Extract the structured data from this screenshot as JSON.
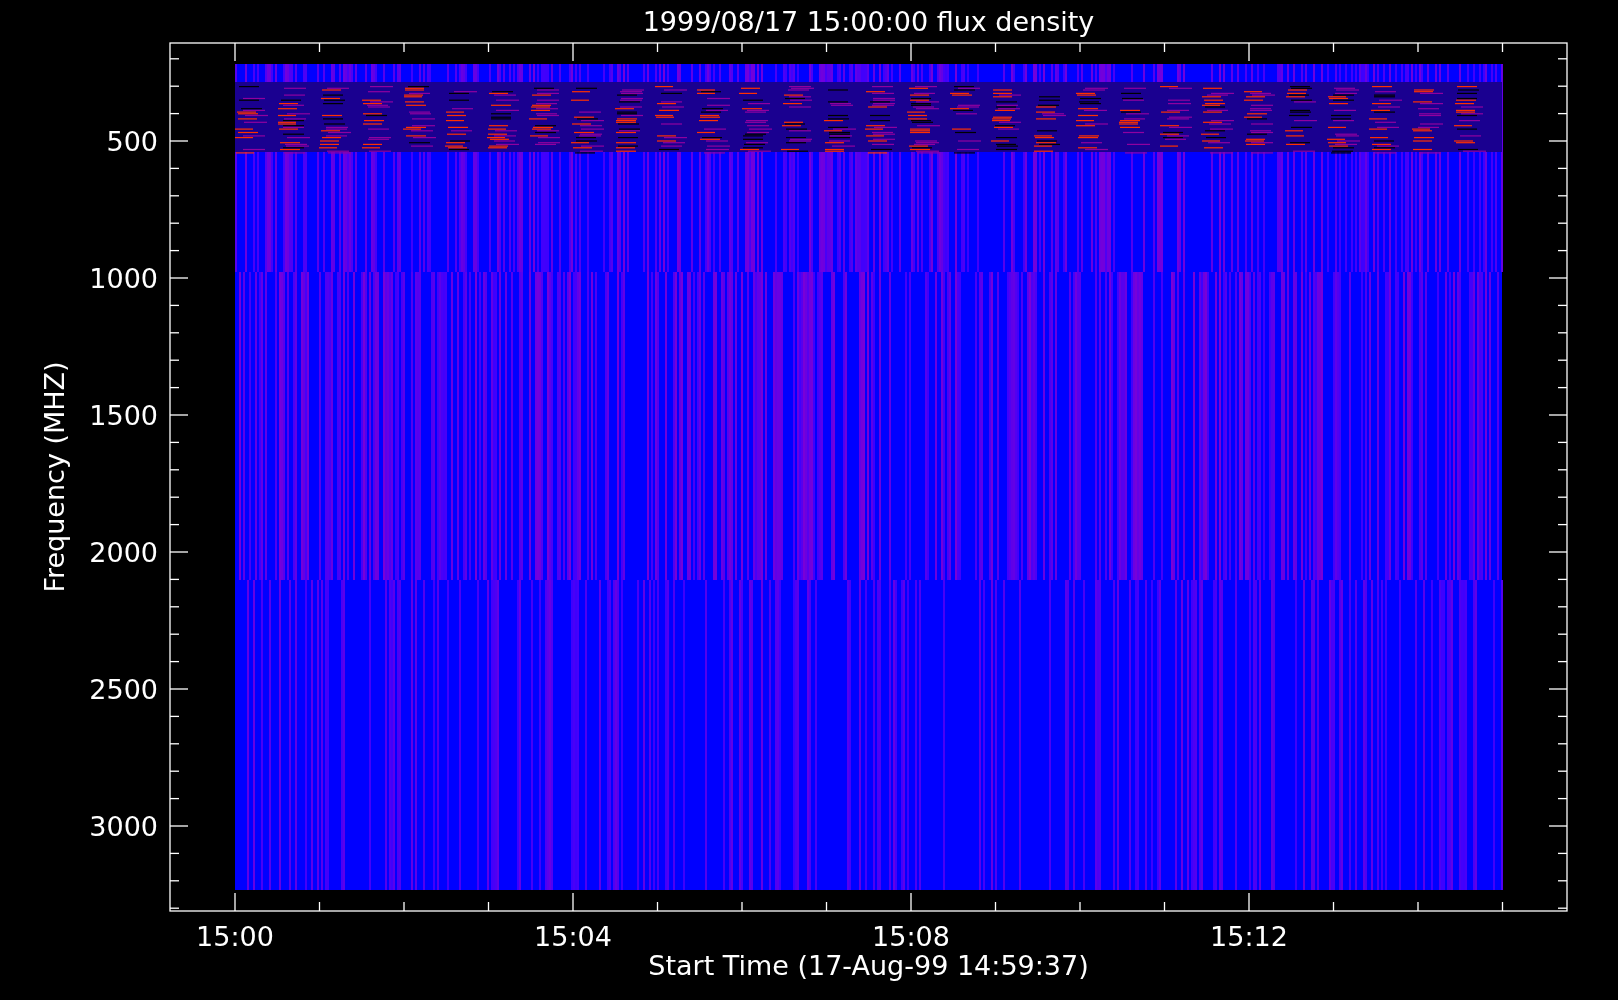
{
  "plot": {
    "title": "1999/08/17 15:00:00 flux density",
    "xlabel": "Start Time (17-Aug-99 14:59:37)",
    "ylabel": "Frequency (MHZ)",
    "yticks": [
      {
        "label": "500"
      },
      {
        "label": "1000"
      },
      {
        "label": "1500"
      },
      {
        "label": "2000"
      },
      {
        "label": "2500"
      },
      {
        "label": "3000"
      }
    ],
    "xticks": [
      {
        "label": "15:00"
      },
      {
        "label": "15:04"
      },
      {
        "label": "15:08"
      },
      {
        "label": "15:12"
      }
    ]
  }
}
